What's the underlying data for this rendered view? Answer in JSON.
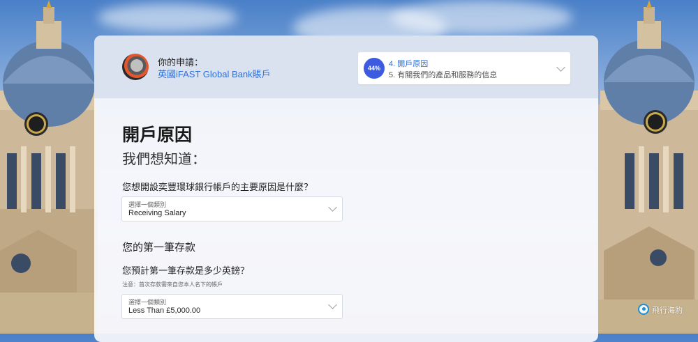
{
  "header": {
    "app_title": "你的申請：",
    "app_name": "英國iFAST Global Bank賬戶",
    "progress": {
      "percent_label": "44%",
      "current_step": "4. 開戶原因",
      "next_step": "5. 有關我們的產品和服務的信息"
    }
  },
  "main": {
    "page_title": "開戶原因",
    "subtitle": "我們想知道：",
    "question1": "您想開設奕豐環球銀行帳戶的主要原因是什麼？",
    "select1": {
      "label": "選擇一個類別",
      "value": "Receiving Salary"
    },
    "section2_title": "您的第一筆存款",
    "question2": "您預計第一筆存款是多少英鎊？",
    "note": "注意：首次存款需來自您本人名下的帳戶",
    "select2": {
      "label": "選擇一個類別",
      "value": "Less Than £5,000.00"
    }
  },
  "watermark": {
    "text": "飛行海豹"
  },
  "colors": {
    "accent": "#2f6fd8",
    "progress_circle": "#3d5be0"
  }
}
